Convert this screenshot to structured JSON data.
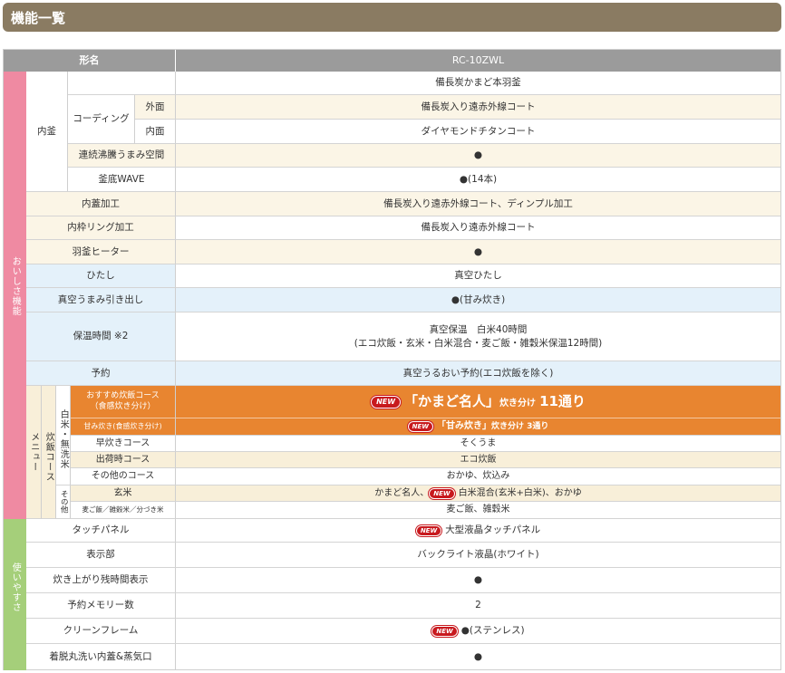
{
  "header": {
    "title": "機能一覧"
  },
  "table": {
    "model_label": "形名",
    "model_value": "RC-10ZWL",
    "categories": {
      "oishisa": "おいしさ機能",
      "menu": "メニュー",
      "suihan_course": "炊飯コース",
      "hakumai": "白米・無洗米",
      "sonota": "その他",
      "tsukaiyasusa": "使いやすさ"
    },
    "uchigama": {
      "label": "内釜",
      "material_value": "備長炭かまど本羽釜",
      "coating_label": "コーディング",
      "outer_label": "外面",
      "outer_value": "備長炭入り遠赤外線コート",
      "inner_label": "内面",
      "inner_value": "ダイヤモンドチタンコート",
      "renzoku_label": "連続沸騰うまみ空間",
      "renzoku_value": "●",
      "wave_label": "釜底WAVE",
      "wave_value": "●(14本)"
    },
    "rows_a": [
      {
        "label": "内蓋加工",
        "value": "備長炭入り遠赤外線コート、ディンプル加工"
      },
      {
        "label": "内枠リング加工",
        "value": "備長炭入り遠赤外線コート"
      },
      {
        "label": "羽釜ヒーター",
        "value": "●"
      }
    ],
    "rows_b": [
      {
        "label": "ひたし",
        "value": "真空ひたし"
      },
      {
        "label": "真空うまみ引き出し",
        "value": "●(甘み炊き)"
      },
      {
        "label": "保温時間 ※2",
        "value_line1": "真空保温　白米40時間",
        "value_line2": "(エコ炊飯・玄米・白米混合・麦ご飯・雑穀米保温12時間)"
      },
      {
        "label": "予約",
        "value": "真空うるおい予約(エコ炊飯を除く)"
      }
    ],
    "menu_rows": {
      "osusume_label_1": "おすすめ炊飯コース",
      "osusume_label_2": "（食感炊き分け）",
      "osusume_new": "NEW",
      "osusume_value_main": "「かまど名人」",
      "osusume_value_small": "炊き分け",
      "osusume_value_count": "11通り",
      "amami_label": "甘み炊き(食感炊き分け)",
      "amami_new": "NEW",
      "amami_value_main": "「甘み炊き」",
      "amami_value_rest": "炊き分け 3通り",
      "hayadaki_label": "早炊きコース",
      "hayadaki_value": "そくうま",
      "shukka_label": "出荷時コース",
      "shukka_value": "エコ炊飯",
      "other_label": "その他のコース",
      "other_value": "おかゆ、炊込み",
      "genmai_label": "玄米",
      "genmai_value_pre": "かまど名人、",
      "genmai_new": "NEW",
      "genmai_value_post": "白米混合(玄米+白米)、おかゆ",
      "mugi_label": "麦ご飯／雑穀米／分づき米",
      "mugi_value": "麦ご飯、雑穀米"
    },
    "rows_c": [
      {
        "label": "タッチパネル",
        "new": "NEW",
        "value": "大型液晶タッチパネル"
      },
      {
        "label": "表示部",
        "value": "バックライト液晶(ホワイト)"
      },
      {
        "label": "炊き上がり残時間表示",
        "value": "●"
      },
      {
        "label": "予約メモリー数",
        "value": "2"
      },
      {
        "label": "クリーンフレーム",
        "new": "NEW",
        "value": "●(ステンレス)"
      },
      {
        "label": "着脱丸洗い内蓋&蒸気口",
        "value": "●"
      }
    ],
    "colors": {
      "header_bar": "#8a7b62",
      "table_head": "#9b9b9b",
      "pink": "#ef8aa2",
      "green": "#a5cf7a",
      "orange": "#e88530",
      "cream": "#fbf5e6",
      "blue": "#e4f1fa",
      "new_badge": "#c8191e"
    }
  }
}
